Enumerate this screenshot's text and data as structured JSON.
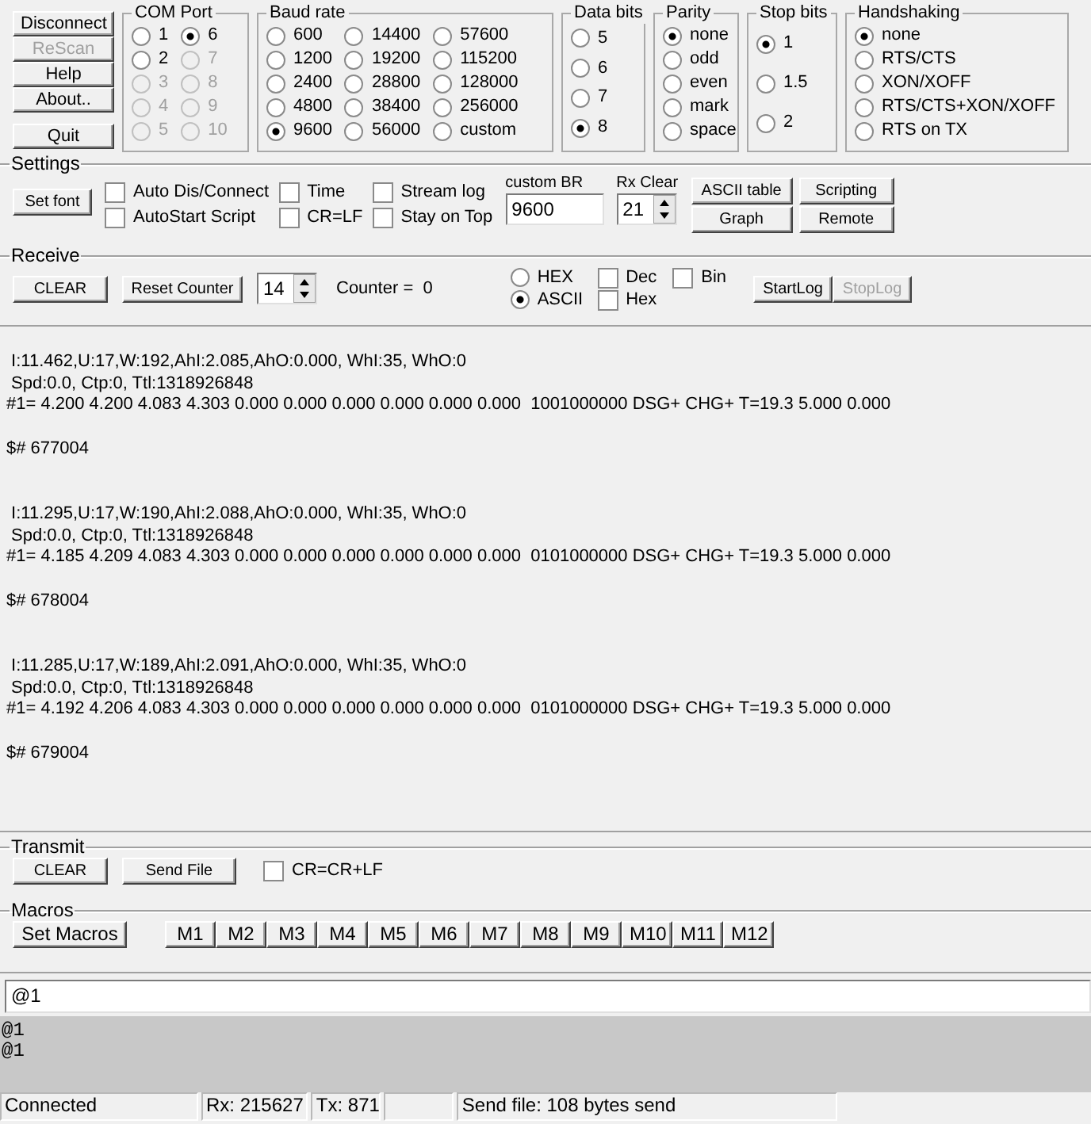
{
  "side_buttons": [
    {
      "label": "Disconnect",
      "disabled": false
    },
    {
      "label": "ReScan",
      "disabled": true
    },
    {
      "label": "Help",
      "disabled": false
    },
    {
      "label": "About..",
      "disabled": false
    },
    {
      "label": "Quit",
      "disabled": false
    }
  ],
  "option_groups": [
    {
      "title": "COM Port",
      "options": [
        {
          "label": "1",
          "selected": false,
          "disabled": false
        },
        {
          "label": "2",
          "selected": false,
          "disabled": false
        },
        {
          "label": "3",
          "selected": false,
          "disabled": true
        },
        {
          "label": "4",
          "selected": false,
          "disabled": true
        },
        {
          "label": "5",
          "selected": false,
          "disabled": true
        },
        {
          "label": "6",
          "selected": true,
          "disabled": false
        },
        {
          "label": "7",
          "selected": false,
          "disabled": true
        },
        {
          "label": "8",
          "selected": false,
          "disabled": true
        },
        {
          "label": "9",
          "selected": false,
          "disabled": true
        },
        {
          "label": "10",
          "selected": false,
          "disabled": true
        }
      ]
    },
    {
      "title": "Baud rate",
      "options": [
        {
          "label": "600",
          "selected": false
        },
        {
          "label": "1200",
          "selected": false
        },
        {
          "label": "2400",
          "selected": false
        },
        {
          "label": "4800",
          "selected": false
        },
        {
          "label": "9600",
          "selected": true
        },
        {
          "label": "14400",
          "selected": false
        },
        {
          "label": "19200",
          "selected": false
        },
        {
          "label": "28800",
          "selected": false
        },
        {
          "label": "38400",
          "selected": false
        },
        {
          "label": "56000",
          "selected": false
        },
        {
          "label": "57600",
          "selected": false
        },
        {
          "label": "115200",
          "selected": false
        },
        {
          "label": "128000",
          "selected": false
        },
        {
          "label": "256000",
          "selected": false
        },
        {
          "label": "custom",
          "selected": false
        }
      ]
    },
    {
      "title": "Data bits",
      "options": [
        {
          "label": "5",
          "selected": false
        },
        {
          "label": "6",
          "selected": false
        },
        {
          "label": "7",
          "selected": false
        },
        {
          "label": "8",
          "selected": true
        }
      ]
    },
    {
      "title": "Parity",
      "options": [
        {
          "label": "none",
          "selected": true
        },
        {
          "label": "odd",
          "selected": false
        },
        {
          "label": "even",
          "selected": false
        },
        {
          "label": "mark",
          "selected": false
        },
        {
          "label": "space",
          "selected": false
        }
      ]
    },
    {
      "title": "Stop bits",
      "options": [
        {
          "label": "1",
          "selected": true
        },
        {
          "label": "1.5",
          "selected": false
        },
        {
          "label": "2",
          "selected": false
        }
      ]
    },
    {
      "title": "Handshaking",
      "options": [
        {
          "label": "none",
          "selected": true
        },
        {
          "label": "RTS/CTS",
          "selected": false
        },
        {
          "label": "XON/XOFF",
          "selected": false
        },
        {
          "label": "RTS/CTS+XON/XOFF",
          "selected": false
        },
        {
          "label": "RTS on TX",
          "selected": false
        }
      ]
    }
  ],
  "settings": {
    "title": "Settings",
    "set_font": "Set font",
    "checks": [
      {
        "label": "Auto Dis/Connect",
        "checked": false
      },
      {
        "label": "AutoStart Script",
        "checked": false
      },
      {
        "label": "Time",
        "checked": false
      },
      {
        "label": "CR=LF",
        "checked": false
      },
      {
        "label": "Stream log",
        "checked": false
      },
      {
        "label": "Stay on Top",
        "checked": false
      }
    ],
    "custom_br": {
      "label": "custom BR",
      "value": "9600"
    },
    "rx_clear": {
      "label": "Rx Clear",
      "value": "21"
    },
    "buttons": [
      "ASCII table",
      "Scripting",
      "Graph",
      "Remote"
    ]
  },
  "receive": {
    "title": "Receive",
    "clear": "CLEAR",
    "reset_counter": "Reset Counter",
    "spin_value": "14",
    "counter": "Counter =  0",
    "modes": [
      {
        "label": "HEX",
        "selected": false
      },
      {
        "label": "ASCII",
        "selected": true
      }
    ],
    "checks": [
      {
        "label": "Dec",
        "checked": false
      },
      {
        "label": "Hex",
        "checked": false
      },
      {
        "label": "Bin",
        "checked": false
      }
    ],
    "log_buttons": [
      {
        "label": "StartLog",
        "disabled": false
      },
      {
        "label": "StopLog",
        "disabled": true
      }
    ]
  },
  "receive_log": [
    {
      "lines": [
        " I:11.462,U:17,W:192,AhI:2.085,AhO:0.000, WhI:35, WhO:0",
        " Spd:0.0, Ctp:0, Ttl:1318926848",
        "#1= 4.200 4.200 4.083 4.303 0.000 0.000 0.000 0.000 0.000 0.000  1001000000 DSG+ CHG+ T=19.3 5.000 0.000"
      ],
      "tail": "$# 677004"
    },
    {
      "lines": [
        " I:11.295,U:17,W:190,AhI:2.088,AhO:0.000, WhI:35, WhO:0",
        " Spd:0.0, Ctp:0, Ttl:1318926848",
        "#1= 4.185 4.209 4.083 4.303 0.000 0.000 0.000 0.000 0.000 0.000  0101000000 DSG+ CHG+ T=19.3 5.000 0.000"
      ],
      "tail": "$# 678004"
    },
    {
      "lines": [
        " I:11.285,U:17,W:189,AhI:2.091,AhO:0.000, WhI:35, WhO:0",
        " Spd:0.0, Ctp:0, Ttl:1318926848",
        "#1= 4.192 4.206 4.083 4.303 0.000 0.000 0.000 0.000 0.000 0.000  0101000000 DSG+ CHG+ T=19.3 5.000 0.000"
      ],
      "tail": "$# 679004"
    }
  ],
  "transmit": {
    "title": "Transmit",
    "clear": "CLEAR",
    "send_file": "Send File",
    "check": {
      "label": "CR=CR+LF",
      "checked": false
    }
  },
  "macros": {
    "title": "Macros",
    "set": "Set Macros",
    "keys": [
      "M1",
      "M2",
      "M3",
      "M4",
      "M5",
      "M6",
      "M7",
      "M8",
      "M9",
      "M10",
      "M11",
      "M12"
    ]
  },
  "input": {
    "value": "@1"
  },
  "sent_log": [
    "@1",
    "@1"
  ],
  "status_bar": {
    "state": "Connected",
    "rx": "Rx: 215627",
    "tx": "Tx: 871",
    "message": "Send file: 108 bytes send"
  }
}
